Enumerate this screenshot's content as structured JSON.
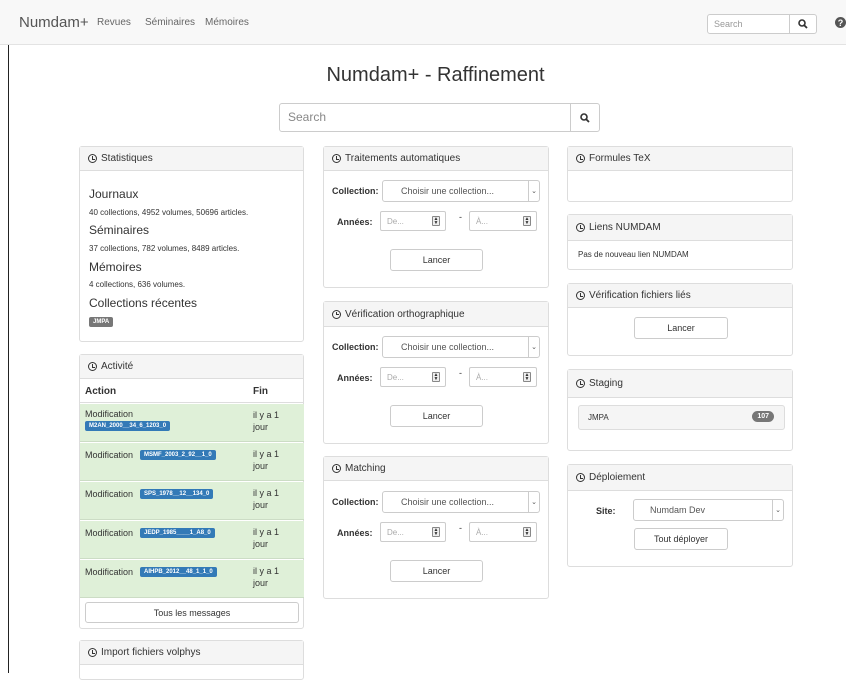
{
  "navbar": {
    "brand": "Numdam+",
    "links": [
      "Revues",
      "Séminaires",
      "Mémoires"
    ],
    "search_placeholder": "Search"
  },
  "page": {
    "title": "Numdam+ - Raffinement",
    "search_placeholder": "Search"
  },
  "statistiques": {
    "title": "Statistiques",
    "journaux_heading": "Journaux",
    "journaux_text": "40 collections, 4952 volumes, 50696 articles.",
    "seminaires_heading": "Séminaires",
    "seminaires_text": "37 collections, 782 volumes, 8489 articles.",
    "memoires_heading": "Mémoires",
    "memoires_text": "4 collections, 636 volumes.",
    "recentes_heading": "Collections récentes",
    "recentes_badge": "JMPA"
  },
  "activite": {
    "title": "Activité",
    "col_action": "Action",
    "col_fin": "Fin",
    "rows": [
      {
        "action": "Modification",
        "badge": "M2AN_2000__34_6_1203_0",
        "fin1": "il y a 1",
        "fin2": "jour"
      },
      {
        "action": "Modification",
        "badge": "MSMF_2003_2_92__1_0",
        "fin1": "il y a 1",
        "fin2": "jour"
      },
      {
        "action": "Modification",
        "badge": "SPS_1978__12__134_0",
        "fin1": "il y a 1",
        "fin2": "jour"
      },
      {
        "action": "Modification",
        "badge": "JEDP_1985____1_A8_0",
        "fin1": "il y a 1",
        "fin2": "jour"
      },
      {
        "action": "Modification",
        "badge": "AIHPB_2012__48_1_1_0",
        "fin1": "il y a 1",
        "fin2": "jour"
      }
    ],
    "all_messages": "Tous les messages"
  },
  "import_volphys": {
    "title": "Import fichiers volphys"
  },
  "traitements": {
    "title": "Traitements automatiques",
    "collection_label": "Collection:",
    "collection_placeholder": "Choisir une collection...",
    "annees_label": "Années:",
    "de_placeholder": "De...",
    "a_placeholder": "À...",
    "dash": "-",
    "launch": "Lancer"
  },
  "orthographe": {
    "title": "Vérification orthographique",
    "collection_label": "Collection:",
    "collection_placeholder": "Choisir une collection...",
    "annees_label": "Années:",
    "de_placeholder": "De...",
    "a_placeholder": "À...",
    "dash": "-",
    "launch": "Lancer"
  },
  "matching": {
    "title": "Matching",
    "collection_label": "Collection:",
    "collection_placeholder": "Choisir une collection...",
    "annees_label": "Années:",
    "de_placeholder": "De...",
    "a_placeholder": "À...",
    "dash": "-",
    "launch": "Lancer"
  },
  "formules": {
    "title": "Formules TeX"
  },
  "liens": {
    "title": "Liens NUMDAM",
    "text": "Pas de nouveau lien NUMDAM"
  },
  "fichiers_lies": {
    "title": "Vérification fichiers liés",
    "launch": "Lancer"
  },
  "staging": {
    "title": "Staging",
    "item": "JMPA",
    "count": "107"
  },
  "deploiement": {
    "title": "Déploiement",
    "site_label": "Site:",
    "site_value": "Numdam Dev",
    "deploy_all": "Tout déployer"
  },
  "colors": {
    "primary": "#337ab7",
    "success_bg": "#dff0d8",
    "badge_gray": "#777777"
  }
}
